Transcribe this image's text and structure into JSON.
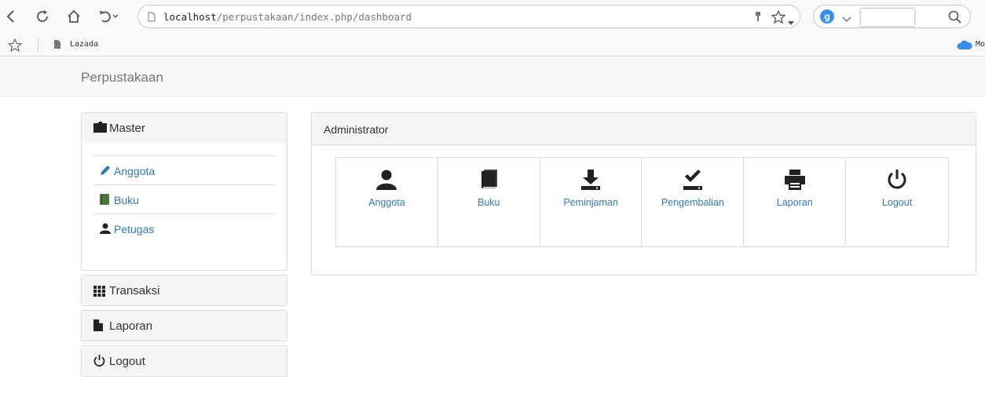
{
  "browser": {
    "url_host": "localhost",
    "url_path": "/perpustakaan/index.php/dashboard",
    "search_engine_letter": "g",
    "bookmarks": [
      "Lazada",
      "Mo"
    ]
  },
  "navbar": {
    "brand": "Perpustakaan"
  },
  "sidebar": {
    "master": {
      "title": "Master",
      "items": [
        {
          "label": "Anggota",
          "icon": "pencil-icon"
        },
        {
          "label": "Buku",
          "icon": "book-icon"
        },
        {
          "label": "Petugas",
          "icon": "user-icon"
        }
      ]
    },
    "transaksi": {
      "title": "Transaksi",
      "icon": "grid-icon"
    },
    "laporan": {
      "title": "Laporan",
      "icon": "file-icon"
    },
    "logout": {
      "title": "Logout",
      "icon": "power-icon"
    }
  },
  "admin": {
    "title": "Administrator",
    "tiles": [
      {
        "label": "Anggota",
        "icon": "user-icon"
      },
      {
        "label": "Buku",
        "icon": "book-icon"
      },
      {
        "label": "Peminjaman",
        "icon": "download-icon"
      },
      {
        "label": "Pengembalian",
        "icon": "check-tray-icon"
      },
      {
        "label": "Laporan",
        "icon": "print-icon"
      },
      {
        "label": "Logout",
        "icon": "power-icon"
      }
    ]
  },
  "colors": {
    "link": "#337ab7",
    "panel_head": "#f5f5f5",
    "border": "#dddddd",
    "icon": "#333333",
    "book_green": "#4a7a3a"
  }
}
